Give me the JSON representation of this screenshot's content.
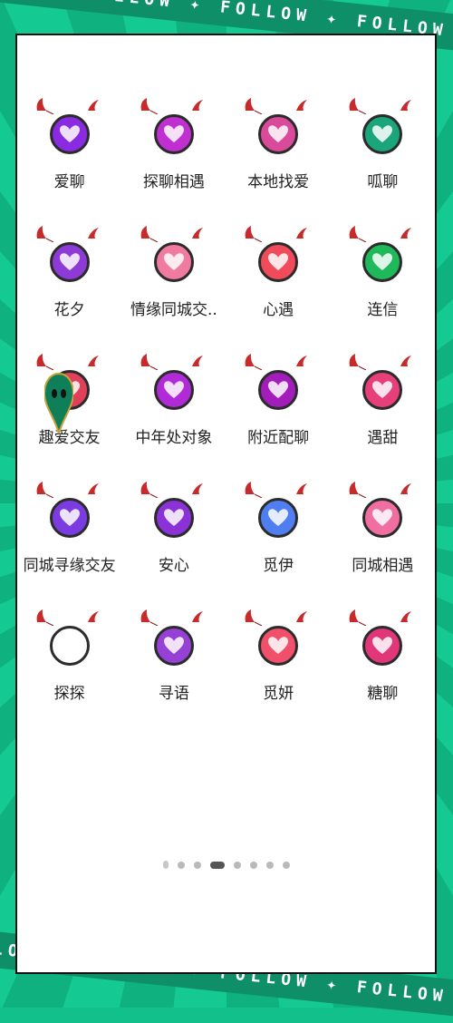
{
  "background": {
    "banner_text": "FOLLOW ✦ FOLLOW ✦ FOLLOW ✦ FOLLOW"
  },
  "apps": [
    {
      "label": "爱聊",
      "icon": "cat-love-icon",
      "color": "#8a2be2"
    },
    {
      "label": "探聊相遇",
      "icon": "heart-chat-icon",
      "color": "#c02fd0"
    },
    {
      "label": "本地找爱",
      "icon": "couple-icon",
      "color": "#d94a9a"
    },
    {
      "label": "呱聊",
      "icon": "frog-chat-icon",
      "color": "#1aa67a"
    },
    {
      "label": "花夕",
      "icon": "clover-icon",
      "color": "#8e3ad6"
    },
    {
      "label": "情缘同城交..",
      "icon": "pink-heart-icon",
      "color": "#f07aa0"
    },
    {
      "label": "心遇",
      "icon": "heart-icon",
      "color": "#f04b5a"
    },
    {
      "label": "连信",
      "icon": "smile-icon",
      "color": "#1fb85a"
    },
    {
      "label": "趣爱交友",
      "icon": "fun-love-icon",
      "color": "#e0405a"
    },
    {
      "label": "中年处对象",
      "icon": "wave-heart-icon",
      "color": "#b02ad8"
    },
    {
      "label": "附近配聊",
      "icon": "twin-hearts-icon",
      "color": "#a21dba"
    },
    {
      "label": "遇甜",
      "icon": "sweet-text-icon",
      "color": "#e63f7a"
    },
    {
      "label": "同城寻缘交友",
      "icon": "photo-heart-icon",
      "color": "#7a3ce0"
    },
    {
      "label": "安心",
      "icon": "chat-bubble-icon",
      "color": "#8a32d8"
    },
    {
      "label": "觅伊",
      "icon": "diamond-heart-icon",
      "color": "#4f7ef0"
    },
    {
      "label": "同城相遇",
      "icon": "phone-heart-icon",
      "color": "#f06fa0"
    },
    {
      "label": "探探",
      "icon": "tantan-icon",
      "color": "#ffffff"
    },
    {
      "label": "寻语",
      "icon": "people-heart-icon",
      "color": "#9540d6"
    },
    {
      "label": "觅妍",
      "icon": "heart-bubble-icon",
      "color": "#f0506a"
    },
    {
      "label": "糖聊",
      "icon": "candy-text-icon",
      "color": "#e2367a"
    }
  ],
  "page_indicator": {
    "total": 8,
    "current": 4
  }
}
